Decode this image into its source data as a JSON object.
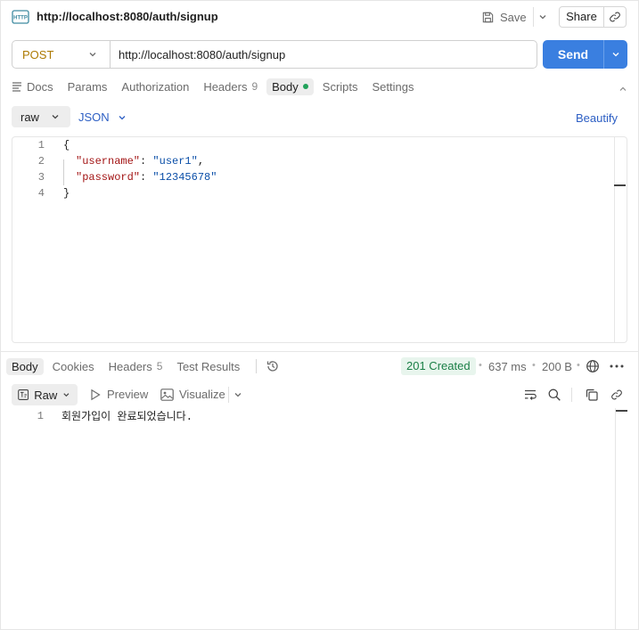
{
  "request": {
    "title": "http://localhost:8080/auth/signup",
    "method": "POST",
    "url": "http://localhost:8080/auth/signup"
  },
  "toolbar": {
    "save_label": "Save",
    "share_label": "Share",
    "send_label": "Send"
  },
  "request_tabs": [
    {
      "label": "Docs",
      "icon": "docs-icon"
    },
    {
      "label": "Params"
    },
    {
      "label": "Authorization"
    },
    {
      "label": "Headers",
      "count": "9"
    },
    {
      "label": "Body",
      "active": true,
      "indicator": "green-dot"
    },
    {
      "label": "Scripts"
    },
    {
      "label": "Settings"
    }
  ],
  "body_options": {
    "mode": "raw",
    "language": "JSON",
    "beautify_label": "Beautify"
  },
  "editor": {
    "lines": [
      {
        "n": "1",
        "text": "{"
      },
      {
        "n": "2",
        "key": "\"username\"",
        "value": "\"user1\"",
        "trail": ","
      },
      {
        "n": "3",
        "key": "\"password\"",
        "value": "\"12345678\"",
        "trail": ""
      },
      {
        "n": "4",
        "text": "}"
      }
    ]
  },
  "response_tabs": [
    {
      "label": "Body",
      "active": true
    },
    {
      "label": "Cookies"
    },
    {
      "label": "Headers",
      "count": "5"
    },
    {
      "label": "Test Results"
    }
  ],
  "response_status": {
    "status": "201 Created",
    "time": "637 ms",
    "size": "200 B",
    "status_color": "#1a7f46"
  },
  "response_toolbar": {
    "format": "Raw",
    "preview_label": "Preview",
    "visualize_label": "Visualize"
  },
  "response_body": {
    "lines": [
      {
        "n": "1",
        "text": "회원가입이 완료되었습니다."
      }
    ]
  },
  "colors": {
    "accent": "#3a7fe0",
    "method": "#ad7a03",
    "link": "#2d5fc4"
  }
}
